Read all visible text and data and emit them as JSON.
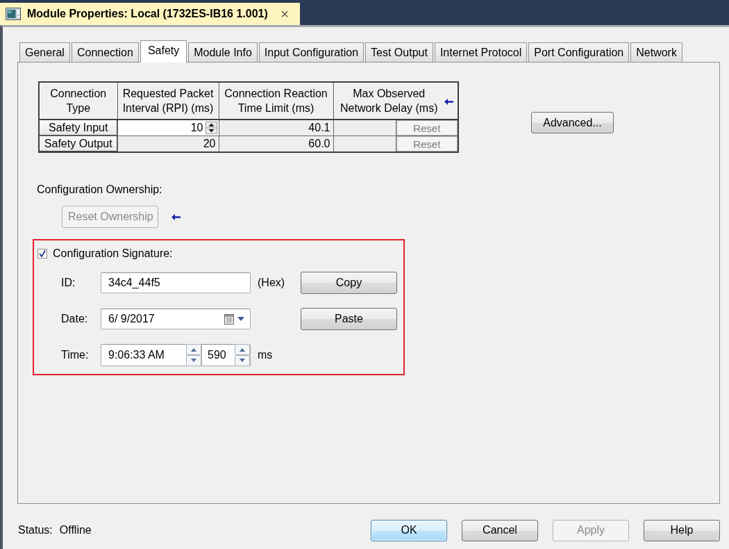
{
  "window": {
    "title": "Module Properties: Local (1732ES-IB16 1.001)",
    "close": "×"
  },
  "tabs": [
    {
      "label": "General",
      "selected": false
    },
    {
      "label": "Connection",
      "selected": false
    },
    {
      "label": "Safety",
      "selected": true
    },
    {
      "label": "Module Info",
      "selected": false
    },
    {
      "label": "Input Configuration",
      "selected": false
    },
    {
      "label": "Test Output",
      "selected": false
    },
    {
      "label": "Internet Protocol",
      "selected": false
    },
    {
      "label": "Port Configuration",
      "selected": false
    },
    {
      "label": "Network",
      "selected": false
    }
  ],
  "connection_table": {
    "columns": [
      {
        "label": "Connection\nType",
        "marked": false
      },
      {
        "label": "Requested Packet\nInterval (RPI) (ms)",
        "marked": false
      },
      {
        "label": "Connection Reaction\nTime Limit (ms)",
        "marked": false
      },
      {
        "label": "Max Observed\nNetwork Delay (ms)",
        "marked": true
      }
    ],
    "rows": [
      {
        "connection_type": "Safety Input",
        "rpi": "10",
        "editable": true,
        "reaction_time_limit": "40.1",
        "reset": {
          "label": "Reset",
          "disabled": true
        }
      },
      {
        "connection_type": "Safety Output",
        "rpi": "20",
        "editable": false,
        "reaction_time_limit": "60.0",
        "reset": {
          "label": "Reset",
          "disabled": true
        }
      }
    ]
  },
  "advanced_button": {
    "label": "Advanced...",
    "disabled": false
  },
  "ownership": {
    "label": "Configuration Ownership:",
    "reset_button": "Reset Ownership",
    "reset_disabled": true,
    "marked": true
  },
  "signature": {
    "highlighted": true,
    "checked": true,
    "label": "Configuration Signature:",
    "id": {
      "label": "ID:",
      "value": "34c4_44f5",
      "unit": "(Hex)"
    },
    "copy_button": {
      "label": "Copy",
      "disabled": false
    },
    "date": {
      "label": "Date:",
      "value": "6/ 9/2017"
    },
    "paste_button": {
      "label": "Paste",
      "disabled": false
    },
    "time": {
      "label": "Time:",
      "value": "9:06:33 AM",
      "ms_value": "590",
      "ms_unit": "ms"
    }
  },
  "status": {
    "label": "Status:",
    "value": "Offline"
  },
  "buttons": [
    {
      "label": "OK",
      "default": true,
      "disabled": false
    },
    {
      "label": "Cancel",
      "default": false,
      "disabled": false
    },
    {
      "label": "Apply",
      "default": false,
      "disabled": true
    },
    {
      "label": "Help",
      "default": false,
      "disabled": false
    }
  ]
}
